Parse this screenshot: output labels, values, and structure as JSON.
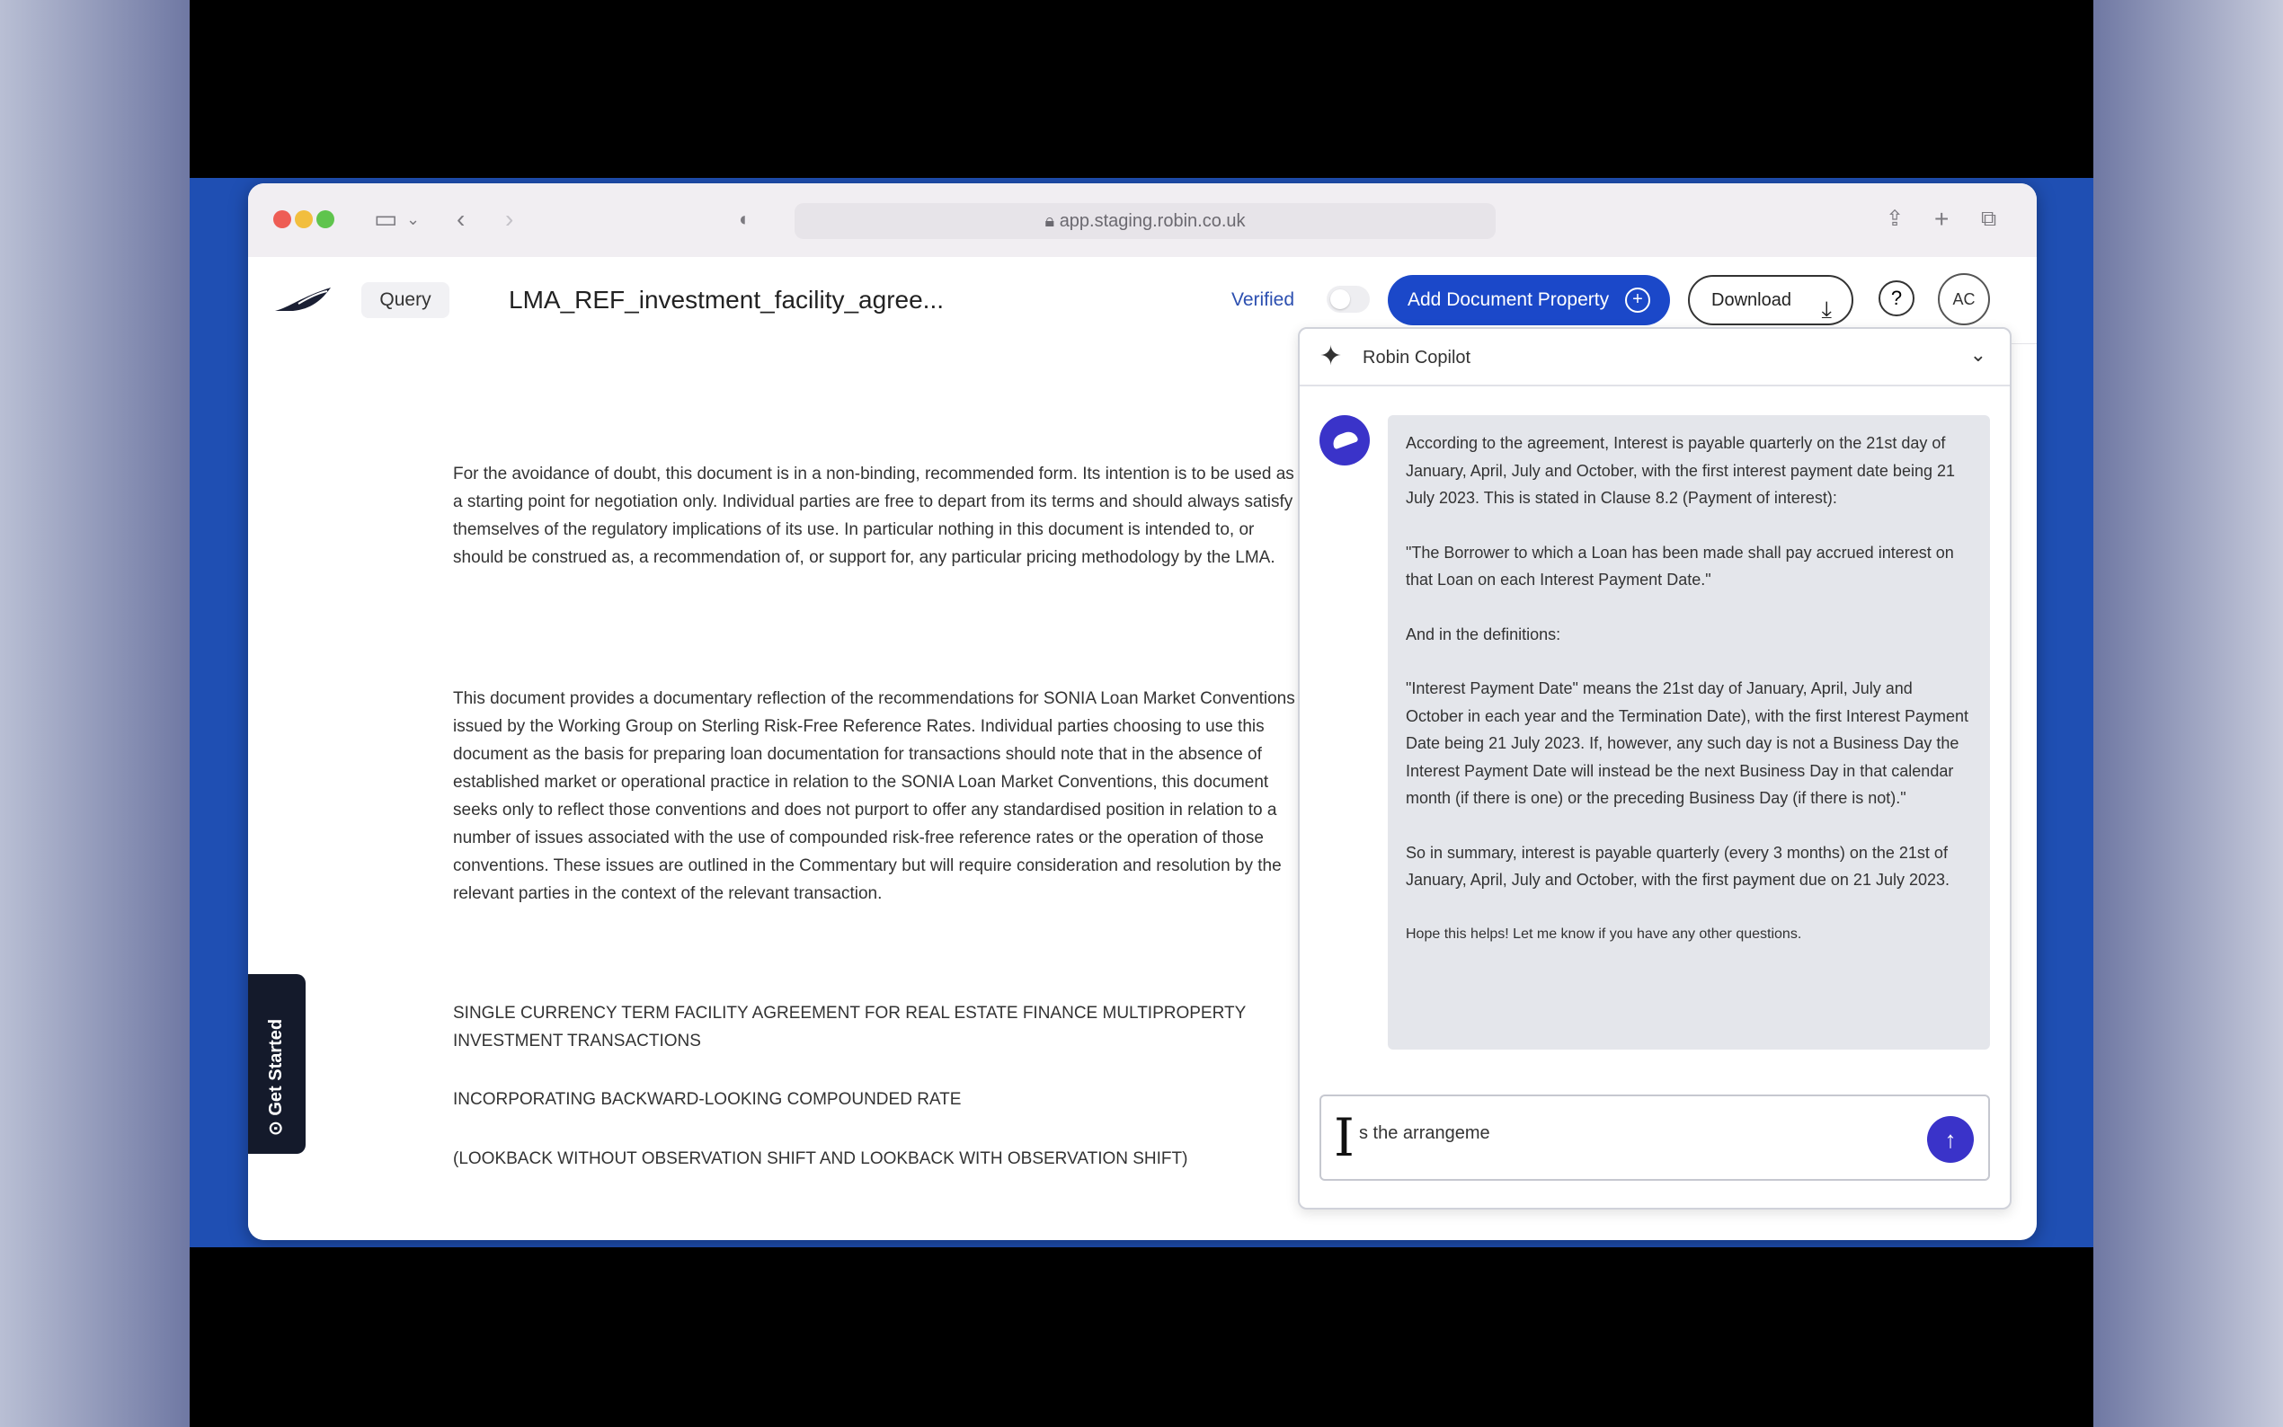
{
  "browser": {
    "address": "app.staging.robin.co.uk"
  },
  "appbar": {
    "query_label": "Query",
    "doc_title": "LMA_REF_investment_facility_agree...",
    "verified_label": "Verified",
    "add_property_label": "Add Document Property",
    "download_label": "Download",
    "avatar_initials": "AC"
  },
  "document": {
    "para1": "For the avoidance of doubt, this document is in a non-binding, recommended form. Its intention is to be used as a starting point for negotiation only. Individual parties are free to depart from its terms and should always satisfy themselves of the regulatory implications of its use. In particular nothing in this document is intended to, or should be construed as, a recommendation of, or support for, any particular pricing methodology by the LMA.",
    "para2": "This document provides a documentary reflection of the recommendations for SONIA Loan Market Conventions issued by the Working Group on Sterling Risk-Free Reference Rates. Individual parties choosing to use this document as the basis for preparing loan documentation for transactions should note that in the absence of established market or operational practice in relation to the SONIA Loan Market Conventions, this document seeks only to reflect those conventions and does not purport to offer any standardised position in relation to a number of issues associated with the use of compounded risk-free reference rates or the operation of those conventions. These issues are outlined in the Commentary but will require consideration and resolution by the relevant parties in the context of the relevant transaction.",
    "heading1": "SINGLE CURRENCY TERM FACILITY AGREEMENT FOR REAL ESTATE FINANCE MULTIPROPERTY INVESTMENT TRANSACTIONS",
    "heading2": "INCORPORATING BACKWARD-LOOKING COMPOUNDED RATE",
    "heading3": "(LOOKBACK WITHOUT OBSERVATION SHIFT AND LOOKBACK WITH OBSERVATION SHIFT)"
  },
  "sidebar_tab": {
    "get_started_label": "Get Started"
  },
  "copilot": {
    "title": "Robin Copilot",
    "message": [
      "According to the agreement, Interest is payable quarterly on the 21st day of January, April, July and October, with the first interest payment date being 21 July 2023. This is stated in Clause 8.2 (Payment of interest):",
      "\"The Borrower to which a Loan has been made shall pay accrued interest on that Loan on each Interest Payment Date.\"",
      "And in the definitions:",
      "\"Interest Payment Date\" means the 21st day of January, April, July and October in each year and the Termination Date), with the first Interest Payment Date being 21 July 2023. If, however, any such day is not a Business Day the Interest Payment Date will instead be the next Business Day in that calendar month (if there is one) or the preceding Business Day (if there is not).\"",
      "So in summary, interest is payable quarterly (every 3 months) on the 21st of January, April, July and October, with the first payment due on 21 July 2023.",
      "Hope this helps! Let me know if you have any other questions."
    ],
    "input_value": "s the arrangeme"
  },
  "icons": {
    "sidebar": "sidebar-toggle-icon",
    "back": "back-arrow-icon",
    "forward": "forward-arrow-icon",
    "shield": "privacy-shield-icon",
    "share": "share-icon",
    "new_tab": "plus-icon",
    "tabs": "tab-overview-icon",
    "download": "download-icon",
    "help": "help-icon",
    "sparkle": "sparkle-icon",
    "chevron": "chevron-down-icon",
    "send": "send-arrow-icon"
  },
  "colors": {
    "accent": "#1b48c9",
    "bot": "#3a33c9",
    "desktop": "#1f4fb3"
  }
}
